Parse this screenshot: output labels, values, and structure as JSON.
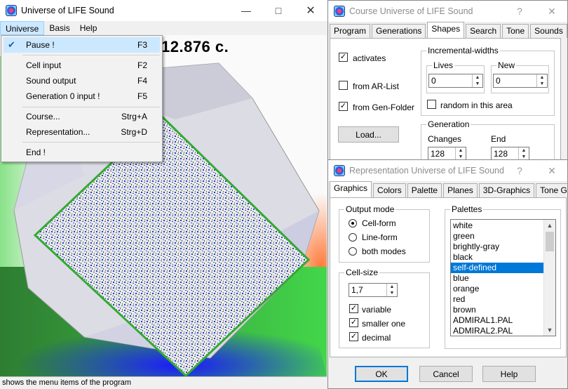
{
  "main_window": {
    "title": "Universe of LIFE Sound",
    "menu": [
      "Universe",
      "Basis",
      "Help"
    ],
    "timer_text": "12.876  c.",
    "status": "shows the menu items of the program"
  },
  "universe_menu": {
    "items": [
      {
        "label": "Pause !",
        "key": "F3",
        "checked": true
      },
      {
        "label": "Cell input",
        "key": "F2"
      },
      {
        "label": "Sound output",
        "key": "F4"
      },
      {
        "label": "Generation 0 input !",
        "key": "F5"
      },
      {
        "label": "Course...",
        "key": "Strg+A"
      },
      {
        "label": "Representation...",
        "key": "Strg+D"
      },
      {
        "label": "End !",
        "key": ""
      }
    ]
  },
  "course_dialog": {
    "title": "Course Universe of LIFE Sound",
    "help_glyph": "?",
    "close_glyph": "✕",
    "tabs": [
      "Program",
      "Generations",
      "Shapes",
      "Search",
      "Tone",
      "Sounds"
    ],
    "selected_tab": "Shapes",
    "activates_label": "activates",
    "from_ar_list_label": "from AR-List",
    "from_gen_folder_label": "from Gen-Folder",
    "load_button": "Load...",
    "incremental_widths": {
      "title": "Incremental-widths",
      "lives_label": "Lives",
      "lives_value": "0",
      "new_label": "New",
      "new_value": "0",
      "random_label": "random in this area"
    },
    "generation": {
      "title": "Generation",
      "changes_label": "Changes",
      "changes_value": "128",
      "end_label": "End",
      "end_value": "128"
    }
  },
  "representation_dialog": {
    "title": "Representation Universe of LIFE Sound",
    "help_glyph": "?",
    "close_glyph": "✕",
    "tabs": [
      "Graphics",
      "Colors",
      "Palette",
      "Planes",
      "3D-Graphics",
      "Tone Graphics"
    ],
    "selected_tab": "Graphics",
    "output_mode": {
      "title": "Output mode",
      "options": [
        "Cell-form",
        "Line-form",
        "both modes"
      ],
      "selected": "Cell-form"
    },
    "cell_size": {
      "title": "Cell-size",
      "value": "1,7",
      "variable_label": "variable",
      "smaller_one_label": "smaller one",
      "decimal_label": "decimal"
    },
    "palettes": {
      "title": "Palettes",
      "items": [
        "white",
        "green",
        "brightly-gray",
        "black",
        "self-defined",
        "blue",
        "orange",
        "red",
        "brown",
        "ADMIRAL1.PAL",
        "ADMIRAL2.PAL"
      ],
      "selected": "self-defined"
    },
    "ok_button": "OK",
    "cancel_button": "Cancel",
    "help_button": "Help"
  }
}
